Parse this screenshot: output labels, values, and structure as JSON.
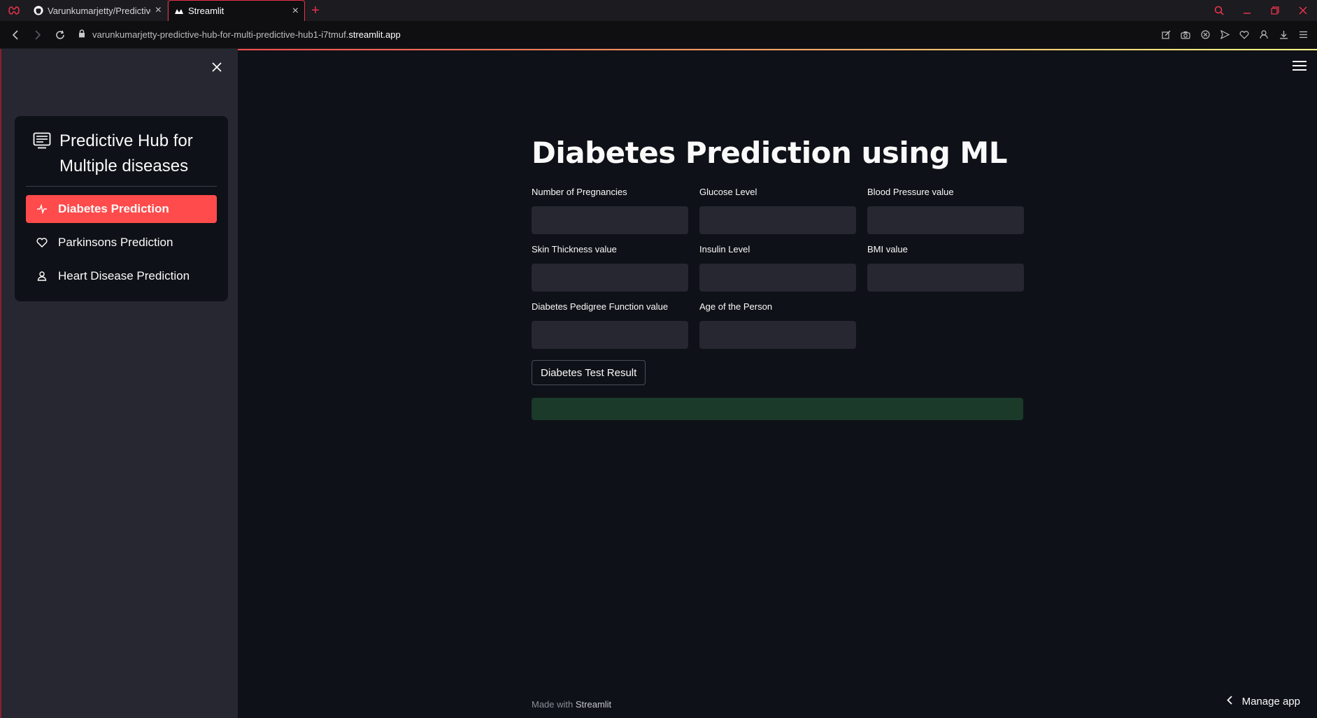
{
  "browser": {
    "tabs": [
      {
        "label": "Varunkumarjetty/Predictive",
        "active": false,
        "icon": "github-icon"
      },
      {
        "label": "Streamlit",
        "active": true,
        "icon": "streamlit-icon"
      }
    ],
    "new_tab": "+",
    "url_path": "varunkumarjetty-predictive-hub-for-multi-predictive-hub1-i7tmuf.",
    "url_host": "streamlit.app"
  },
  "sidebar": {
    "title": "Predictive Hub for Multiple diseases",
    "items": [
      {
        "label": "Diabetes Prediction",
        "icon": "activity-icon",
        "active": true
      },
      {
        "label": "Parkinsons Prediction",
        "icon": "heart-icon",
        "active": false
      },
      {
        "label": "Heart Disease Prediction",
        "icon": "person-icon",
        "active": false
      }
    ]
  },
  "main": {
    "title": "Diabetes Prediction using ML",
    "fields": [
      {
        "label": "Number of Pregnancies",
        "value": ""
      },
      {
        "label": "Glucose Level",
        "value": ""
      },
      {
        "label": "Blood Pressure value",
        "value": ""
      },
      {
        "label": "Skin Thickness value",
        "value": ""
      },
      {
        "label": "Insulin Level",
        "value": ""
      },
      {
        "label": "BMI value",
        "value": ""
      },
      {
        "label": "Diabetes Pedigree Function value",
        "value": ""
      },
      {
        "label": "Age of the Person",
        "value": ""
      }
    ],
    "button_label": "Diabetes Test Result",
    "result_text": ""
  },
  "footer": {
    "made_with": "Made with",
    "brand": "Streamlit",
    "manage_app": "Manage app"
  },
  "colors": {
    "accent": "#ff4b4b",
    "background": "#0e1117",
    "sidebar": "#262730",
    "success_bg": "#1b3a2a",
    "browser_accent": "#e8334a"
  }
}
